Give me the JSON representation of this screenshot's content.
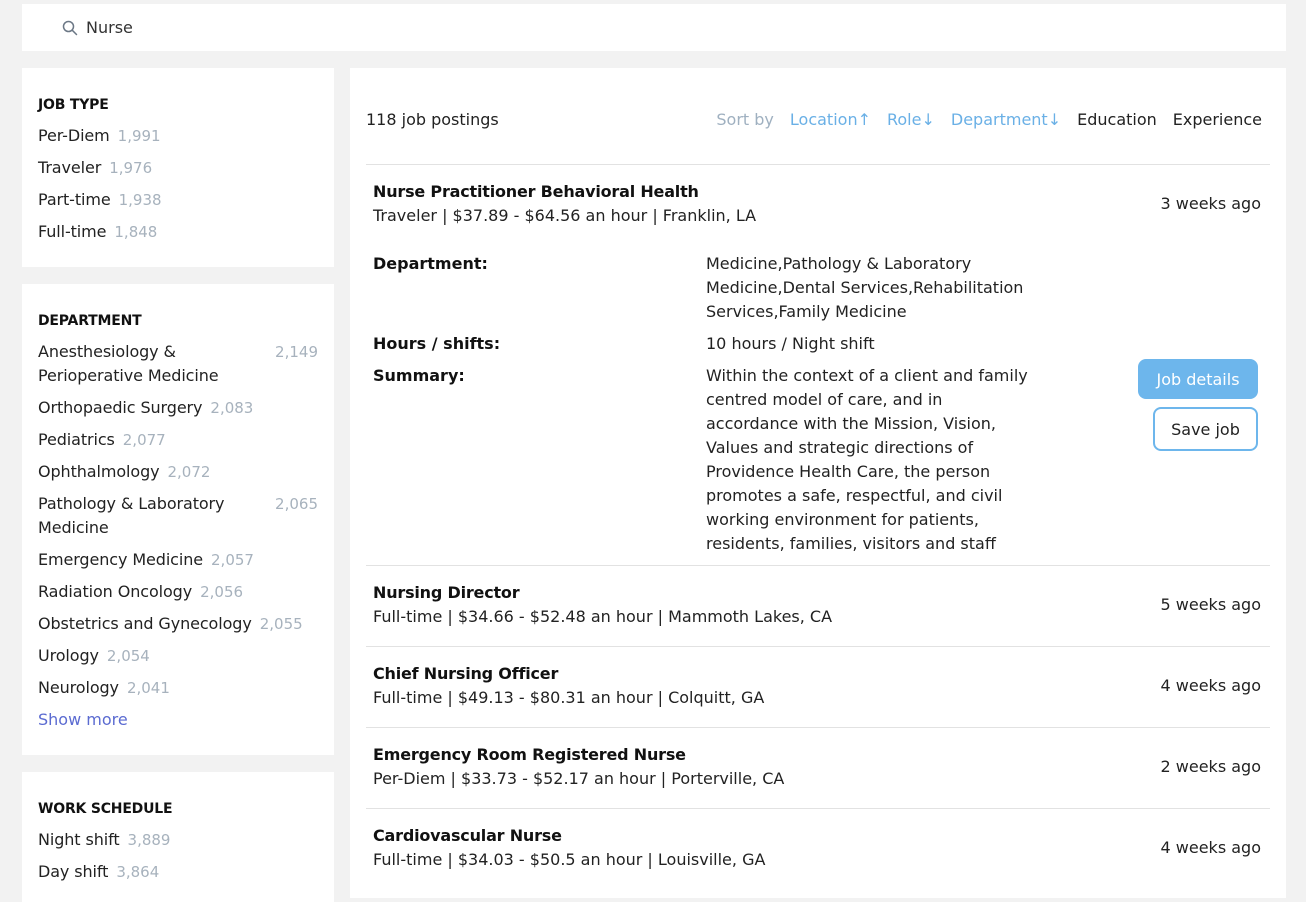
{
  "search": {
    "value": "Nurse"
  },
  "filters": {
    "job_type": {
      "title": "JOB TYPE",
      "items": [
        {
          "label": "Per-Diem",
          "count": "1,991"
        },
        {
          "label": "Traveler",
          "count": "1,976"
        },
        {
          "label": "Part-time",
          "count": "1,938"
        },
        {
          "label": "Full-time",
          "count": "1,848"
        }
      ]
    },
    "department": {
      "title": "DEPARTMENT",
      "items": [
        {
          "label": "Anesthesiology & Perioperative Medicine",
          "count": "2,149"
        },
        {
          "label": "Orthopaedic Surgery",
          "count": "2,083"
        },
        {
          "label": "Pediatrics",
          "count": "2,077"
        },
        {
          "label": "Ophthalmology",
          "count": "2,072"
        },
        {
          "label": "Pathology & Laboratory Medicine",
          "count": "2,065"
        },
        {
          "label": "Emergency Medicine",
          "count": "2,057"
        },
        {
          "label": "Radiation Oncology",
          "count": "2,056"
        },
        {
          "label": "Obstetrics and Gynecology",
          "count": "2,055"
        },
        {
          "label": "Urology",
          "count": "2,054"
        },
        {
          "label": "Neurology",
          "count": "2,041"
        }
      ],
      "show_more": "Show more"
    },
    "work_schedule": {
      "title": "WORK SCHEDULE",
      "items": [
        {
          "label": "Night shift",
          "count": "3,889"
        },
        {
          "label": "Day shift",
          "count": "3,864"
        }
      ]
    }
  },
  "results": {
    "count_label": "118 job postings",
    "sort_by": "Sort by",
    "sorts": [
      "Location↑",
      "Role↓",
      "Department↓",
      "Education",
      "Experience"
    ]
  },
  "jobs": [
    {
      "title": "Nurse Practitioner Behavioral Health",
      "meta": "Traveler | $37.89 - $64.56 an hour | Franklin, LA",
      "ago": "3 weeks ago",
      "department_label": "Department:",
      "department": "Medicine,Pathology & Laboratory Medicine,Dental Services,Rehabilitation Services,Family Medicine",
      "hours_label": "Hours / shifts:",
      "hours": "10 hours / Night shift",
      "summary_label": "Summary:",
      "summary": "Within the context of a client and family centred model of care, and in accordance with the Mission, Vision, Values and strategic directions of Providence Health Care, the person promotes a safe, respectful, and civil working environment for patients, residents, families, visitors and staff",
      "details_button": "Job details",
      "save_button": "Save job"
    },
    {
      "title": "Nursing Director",
      "meta": "Full-time | $34.66 - $52.48 an hour | Mammoth Lakes, CA",
      "ago": "5 weeks ago"
    },
    {
      "title": "Chief Nursing Officer",
      "meta": "Full-time | $49.13 - $80.31 an hour | Colquitt, GA",
      "ago": "4 weeks ago"
    },
    {
      "title": "Emergency Room Registered Nurse",
      "meta": "Per-Diem | $33.73 - $52.17 an hour | Porterville, CA",
      "ago": "2 weeks ago"
    },
    {
      "title": "Cardiovascular Nurse",
      "meta": "Full-time | $34.03 - $50.5 an hour | Louisville, GA",
      "ago": "4 weeks ago"
    }
  ]
}
